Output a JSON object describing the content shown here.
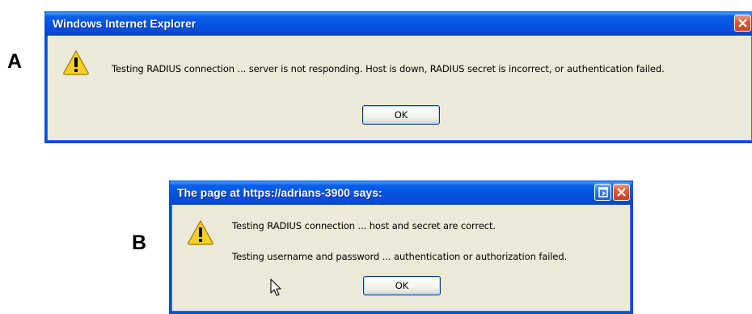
{
  "panel_a": {
    "letter": "A",
    "title": "Windows Internet Explorer",
    "message": "Testing RADIUS connection ... server is not responding. Host is down, RADIUS secret is incorrect, or authentication failed.",
    "ok_label": "OK",
    "icon": "warning-icon"
  },
  "panel_b": {
    "letter": "B",
    "title": "The page at https://adrians-3900 says:",
    "message_line1": "Testing RADIUS connection ... host and secret are correct.",
    "message_line2": "Testing username and password ... authentication or authorization failed.",
    "ok_label": "OK",
    "icon": "warning-icon"
  },
  "colors": {
    "titlebar": "#0452e0",
    "dialog_bg": "#ece9d8",
    "close_button": "#e25a35",
    "warning_fill": "#f6d024"
  }
}
